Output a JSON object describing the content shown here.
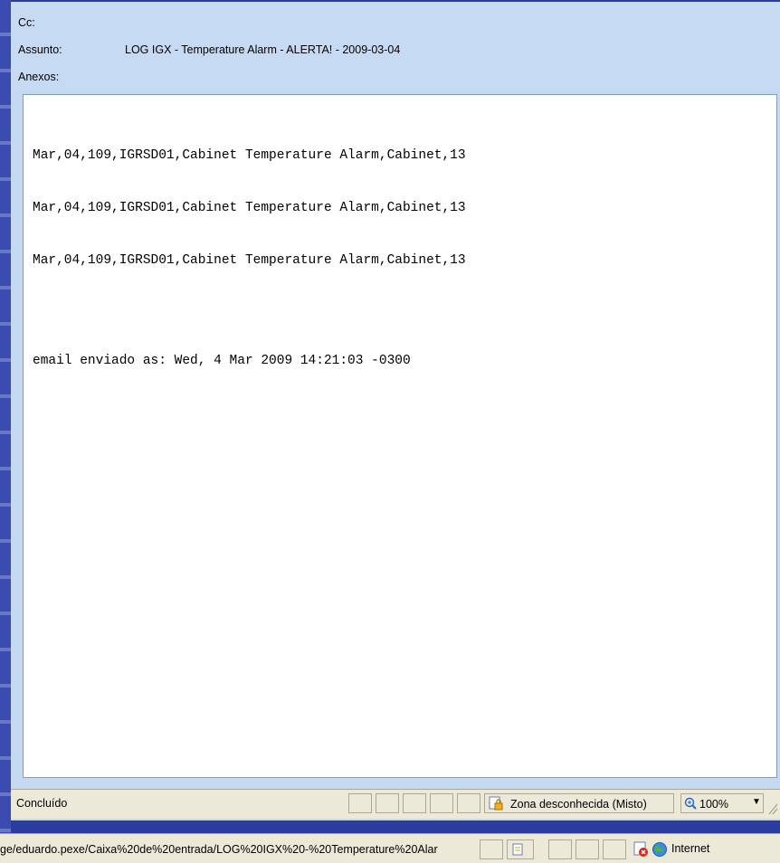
{
  "header": {
    "cc_label": "Cc:",
    "cc_value": "",
    "subject_label": "Assunto:",
    "subject_value": "LOG IGX - Temperature Alarm - ALERTA! - 2009-03-04",
    "attachments_label": "Anexos:",
    "attachments_value": ""
  },
  "message": {
    "lines": [
      "Mar,04,109,IGRSD01,Cabinet Temperature Alarm,Cabinet,13",
      "Mar,04,109,IGRSD01,Cabinet Temperature Alarm,Cabinet,13",
      "Mar,04,109,IGRSD01,Cabinet Temperature Alarm,Cabinet,13"
    ],
    "footer": "email enviado as: Wed, 4 Mar 2009 14:21:03 -0300"
  },
  "status_bar": {
    "status": "Concluído",
    "zone": "Zona desconhecida (Misto)",
    "zoom": "100%",
    "zone_icon": "lock-warning-icon",
    "zoom_icon": "magnifier-icon"
  },
  "outer_status_bar": {
    "url": "ge/eduardo.pexe/Caixa%20de%20entrada/LOG%20IGX%20-%20Temperature%20Alar",
    "zone": "Internet",
    "error_icon": "error-icon",
    "zone_icon": "globe-icon"
  },
  "colors": {
    "header_bg": "#c7daf3",
    "backdrop": "#2b3c9e",
    "statusbar_bg": "#ece9d8"
  }
}
